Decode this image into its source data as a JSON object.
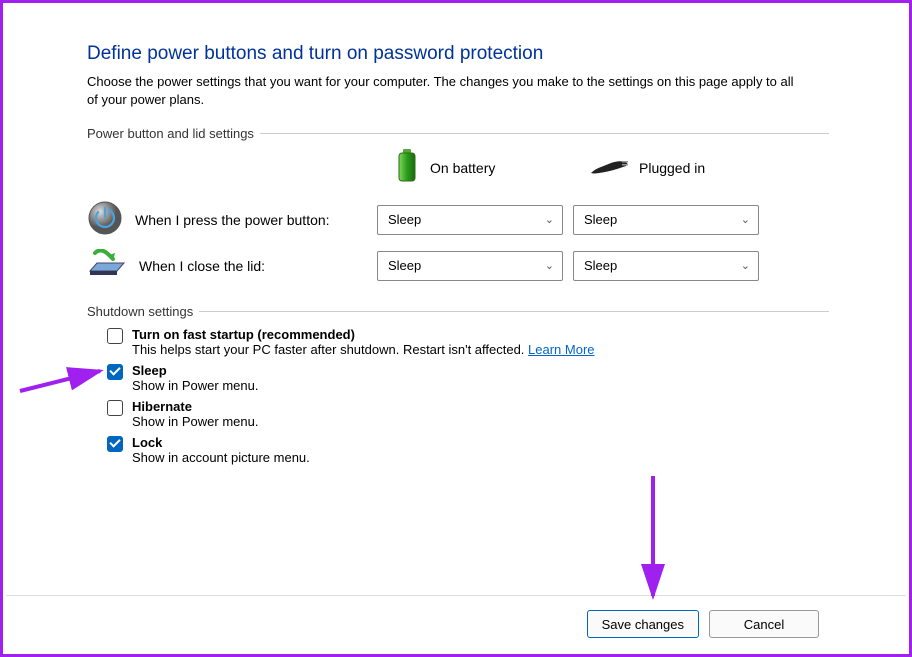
{
  "title": "Define power buttons and turn on password protection",
  "description": "Choose the power settings that you want for your computer. The changes you make to the settings on this page apply to all of your power plans.",
  "section1": {
    "header": "Power button and lid settings",
    "col_battery": "On battery",
    "col_plugged": "Plugged in",
    "power_button_label": "When I press the power button:",
    "lid_label": "When I close the lid:",
    "power_button_battery": "Sleep",
    "power_button_plugged": "Sleep",
    "lid_battery": "Sleep",
    "lid_plugged": "Sleep"
  },
  "section2": {
    "header": "Shutdown settings",
    "fast": {
      "label": "Turn on fast startup (recommended)",
      "desc_before": "This helps start your PC faster after shutdown. Restart isn't affected. ",
      "learn_more": "Learn More",
      "checked": false
    },
    "sleep": {
      "label": "Sleep",
      "desc": "Show in Power menu.",
      "checked": true
    },
    "hibernate": {
      "label": "Hibernate",
      "desc": "Show in Power menu.",
      "checked": false
    },
    "lock": {
      "label": "Lock",
      "desc": "Show in account picture menu.",
      "checked": true
    }
  },
  "buttons": {
    "save": "Save changes",
    "cancel": "Cancel"
  },
  "colors": {
    "annotation": "#a020f0",
    "accent": "#0067c0",
    "title": "#003399"
  }
}
